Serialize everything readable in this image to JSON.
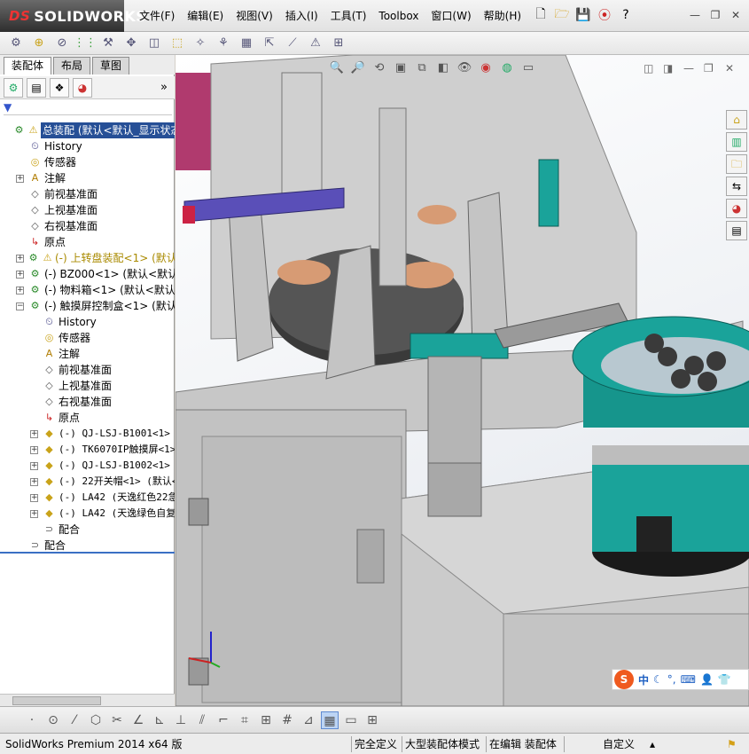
{
  "app": {
    "logo_prefix": "DS",
    "logo_text": "SOLIDWORKS"
  },
  "menu": [
    "文件(F)",
    "编辑(E)",
    "视图(V)",
    "插入(I)",
    "工具(T)",
    "Toolbox",
    "窗口(W)",
    "帮助(H)"
  ],
  "panel": {
    "tabs": [
      "装配体",
      "布局",
      "草图"
    ],
    "active_tab": "装配体",
    "collapse_glyph": "»",
    "filter_glyph": "▼"
  },
  "tree": [
    {
      "label": "总装配 (默认<默认_显示状态",
      "indent": 0,
      "icon": "assembly-warning",
      "selected": true
    },
    {
      "label": "History",
      "indent": 1,
      "icon": "history"
    },
    {
      "label": "传感器",
      "indent": 1,
      "icon": "sensor"
    },
    {
      "label": "注解",
      "indent": 1,
      "icon": "annotation",
      "expand": "+"
    },
    {
      "label": "前视基准面",
      "indent": 1,
      "icon": "plane"
    },
    {
      "label": "上视基准面",
      "indent": 1,
      "icon": "plane"
    },
    {
      "label": "右视基准面",
      "indent": 1,
      "icon": "plane"
    },
    {
      "label": "原点",
      "indent": 1,
      "icon": "origin"
    },
    {
      "label": "(-) 上转盘装配<1> (默认",
      "indent": 1,
      "icon": "subassembly-warning",
      "expand": "+",
      "yellow": true
    },
    {
      "label": "(-) BZ000<1> (默认<默认_显",
      "indent": 1,
      "icon": "subassembly",
      "expand": "+"
    },
    {
      "label": "(-) 物料箱<1> (默认<默认_显",
      "indent": 1,
      "icon": "subassembly",
      "expand": "+"
    },
    {
      "label": "(-) 触摸屏控制盒<1> (默认",
      "indent": 1,
      "icon": "subassembly",
      "expand": "−"
    },
    {
      "label": "History",
      "indent": 2,
      "icon": "history"
    },
    {
      "label": "传感器",
      "indent": 2,
      "icon": "sensor"
    },
    {
      "label": "注解",
      "indent": 2,
      "icon": "annotation"
    },
    {
      "label": "前视基准面",
      "indent": 2,
      "icon": "plane"
    },
    {
      "label": "上视基准面",
      "indent": 2,
      "icon": "plane"
    },
    {
      "label": "右视基准面",
      "indent": 2,
      "icon": "plane"
    },
    {
      "label": "原点",
      "indent": 2,
      "icon": "origin"
    },
    {
      "label": "(-) QJ-LSJ-B1001<1> (默",
      "indent": 2,
      "icon": "part",
      "expand": "+",
      "mono": true
    },
    {
      "label": "(-) TK6070IP触摸屏<1>",
      "indent": 2,
      "icon": "part",
      "expand": "+",
      "mono": true
    },
    {
      "label": "(-) QJ-LSJ-B1002<1> (默",
      "indent": 2,
      "icon": "part",
      "expand": "+",
      "mono": true
    },
    {
      "label": "(-) 22开关帽<1> (默认<",
      "indent": 2,
      "icon": "part",
      "expand": "+",
      "mono": true
    },
    {
      "label": "(-) LA42 (天逸红色22急",
      "indent": 2,
      "icon": "part",
      "expand": "+",
      "mono": true
    },
    {
      "label": "(-) LA42 (天逸绿色自复",
      "indent": 2,
      "icon": "part",
      "expand": "+",
      "mono": true
    },
    {
      "label": "配合",
      "indent": 2,
      "icon": "mates"
    },
    {
      "label": "配合",
      "indent": 1,
      "icon": "mates"
    }
  ],
  "ime": {
    "logo": "S",
    "label": "中"
  },
  "status": {
    "app_version": "SolidWorks Premium 2014 x64 版",
    "definition": "完全定义",
    "mode": "大型装配体模式",
    "editing": "在编辑 装配体",
    "units": "自定义"
  },
  "colors": {
    "selection": "#264f96",
    "teal": "#1aa39a",
    "frame": "#bdbdbd",
    "purple": "#5a4fb8"
  }
}
